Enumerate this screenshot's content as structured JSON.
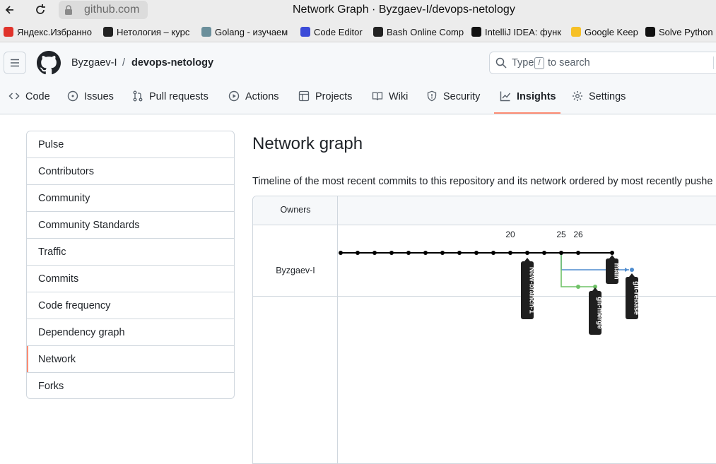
{
  "browser": {
    "url": "github.com",
    "window_title": "Network Graph · Byzgaev-I/devops-netology",
    "bookmarks": [
      {
        "label": "Яндекс.Избранно",
        "color": "#e0332b"
      },
      {
        "label": "Нетология – курс",
        "color": "#222222"
      },
      {
        "label": "Golang - изучаем",
        "color": "#6b8f9b"
      },
      {
        "label": "Code Editor",
        "color": "#3b4bd8"
      },
      {
        "label": "Bash Online Comp",
        "color": "#222222"
      },
      {
        "label": "IntelliJ IDEA: функ",
        "color": "#111111"
      },
      {
        "label": "Google Keep",
        "color": "#f6c026"
      },
      {
        "label": "Solve Python",
        "color": "#111111"
      }
    ]
  },
  "header": {
    "owner": "Byzgaev-I",
    "separator": "/",
    "repo": "devops-netology",
    "search_before": "Type",
    "search_key": "/",
    "search_after": "to search"
  },
  "tabs": [
    {
      "label": "Code",
      "icon": "code-icon"
    },
    {
      "label": "Issues",
      "icon": "issue-icon"
    },
    {
      "label": "Pull requests",
      "icon": "pull-request-icon"
    },
    {
      "label": "Actions",
      "icon": "play-icon"
    },
    {
      "label": "Projects",
      "icon": "table-icon"
    },
    {
      "label": "Wiki",
      "icon": "book-icon"
    },
    {
      "label": "Security",
      "icon": "shield-icon"
    },
    {
      "label": "Insights",
      "icon": "graph-icon",
      "selected": true
    },
    {
      "label": "Settings",
      "icon": "gear-icon"
    }
  ],
  "sidebar": {
    "items": [
      "Pulse",
      "Contributors",
      "Community",
      "Community Standards",
      "Traffic",
      "Commits",
      "Code frequency",
      "Dependency graph",
      "Network",
      "Forks"
    ],
    "selected": "Network"
  },
  "main": {
    "title": "Network graph",
    "description": "Timeline of the most recent commits to this repository and its network ordered by most recently pushe"
  },
  "network": {
    "owners_header": "Owners",
    "owner_name": "Byzgaev-I",
    "dates": [
      "20",
      "25",
      "26"
    ],
    "branches": [
      "New-branch-1",
      "main",
      "git-merge",
      "git-rebase"
    ],
    "colors": {
      "main": "#000000",
      "rebase": "#4e8ccf",
      "merge": "#6fc267",
      "accent": "#fd8c73"
    }
  }
}
